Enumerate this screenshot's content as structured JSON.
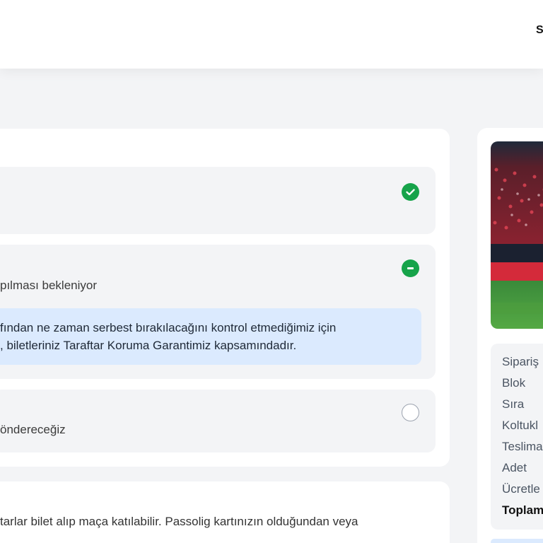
{
  "header": {
    "cut_text": "S"
  },
  "steps": [
    {
      "status": "completed",
      "icon": "check-circle-icon"
    },
    {
      "status": "in-progress",
      "icon": "minus-circle-icon",
      "text": "pılması bekleniyor"
    },
    {
      "status": "pending",
      "icon": "empty-circle-icon",
      "text": "öndereceğiz"
    }
  ],
  "info": {
    "line1": "fından ne zaman serbest bırakılacağını kontrol etmediğimiz için",
    "line2": ", biletleriniz Taraftar Koruma Garantimiz kapsamındadır."
  },
  "bottom_text": "tarlar bilet alıp maça katılabilir. Passolig kartınızın olduğundan veya",
  "order_details": {
    "labels": [
      "Sipariş",
      "Blok",
      "Sıra",
      "Koltukl",
      "Teslima",
      "Adet",
      "Ücretle",
      "Toplam"
    ]
  },
  "colors": {
    "success": "#16a34a",
    "info_bg": "#dbeafe",
    "card_bg": "#ffffff",
    "page_bg": "#f3f4f6"
  }
}
